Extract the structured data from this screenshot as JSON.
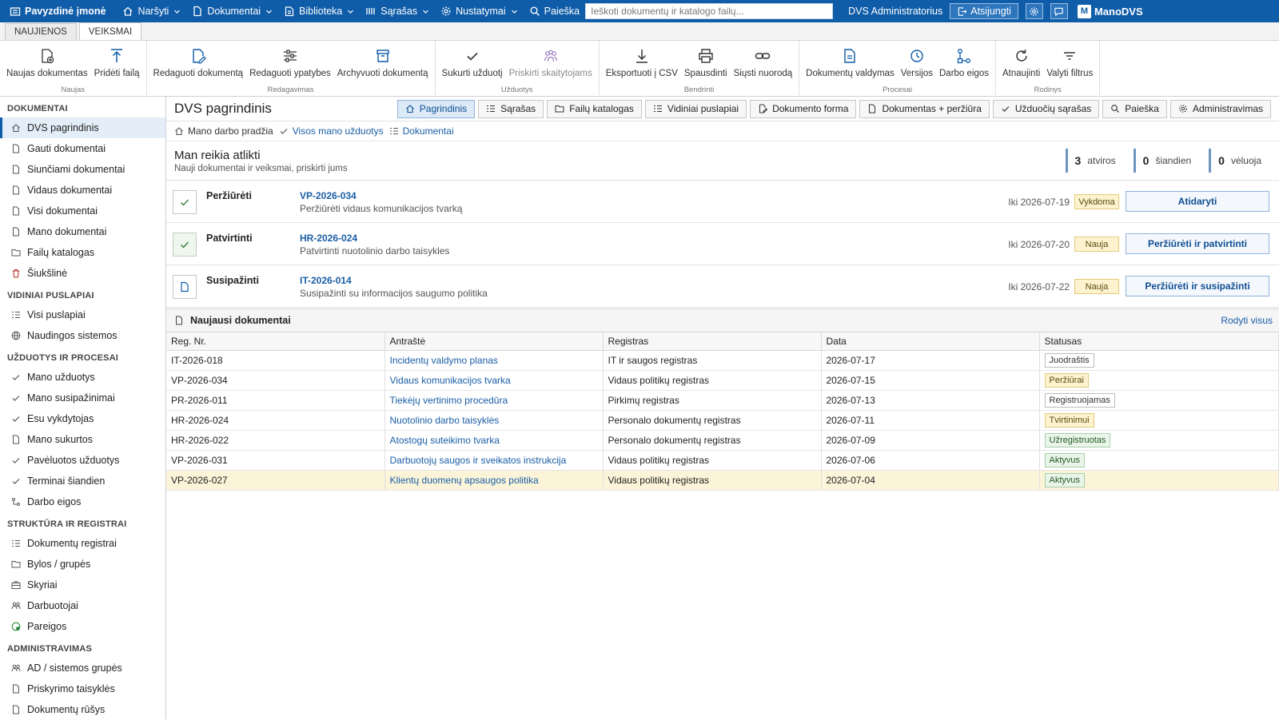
{
  "topbar": {
    "company": "Pavyzdinė įmonė",
    "menus": [
      "Naršyti",
      "Dokumentai",
      "Biblioteka",
      "Sąrašas",
      "Nustatymai"
    ],
    "search_label": "Paieška",
    "search_placeholder": "Ieškoti dokumentų ir katalogo failų...",
    "user": "DVS Administratorius",
    "logout": "Atsijungti",
    "brand": "ManoDVS",
    "brand_logo": "M"
  },
  "ribbon_tabs": [
    "NAUJIENOS",
    "VEIKSMAI"
  ],
  "ribbon": {
    "groups": [
      {
        "label": "Naujas",
        "buttons": [
          "Naujas dokumentas",
          "Pridėti failą"
        ]
      },
      {
        "label": "Redagavimas",
        "buttons": [
          "Redaguoti dokumentą",
          "Redaguoti ypatybes",
          "Archyvuoti dokumentą"
        ]
      },
      {
        "label": "Užduotys",
        "buttons": [
          "Sukurti užduotį",
          "Priskirti skaitytojams"
        ]
      },
      {
        "label": "Bendrinti",
        "buttons": [
          "Eksportuoti į CSV",
          "Spausdinti",
          "Siųsti nuorodą"
        ]
      },
      {
        "label": "Procesai",
        "buttons": [
          "Dokumentų valdymas",
          "Versijos",
          "Darbo eigos"
        ]
      },
      {
        "label": "Rodinys",
        "buttons": [
          "Atnaujinti",
          "Valyti filtrus"
        ]
      }
    ]
  },
  "sidebar": {
    "sections": [
      {
        "title": "DOKUMENTAI",
        "items": [
          "DVS pagrindinis",
          "Gauti dokumentai",
          "Siunčiami dokumentai",
          "Vidaus dokumentai",
          "Visi dokumentai",
          "Mano dokumentai",
          "Failų katalogas",
          "Šiukšlinė"
        ]
      },
      {
        "title": "VIDINIAI PUSLAPIAI",
        "items": [
          "Visi puslapiai",
          "Naudingos sistemos"
        ]
      },
      {
        "title": "UŽDUOTYS IR PROCESAI",
        "items": [
          "Mano užduotys",
          "Mano susipažinimai",
          "Esu vykdytojas",
          "Mano sukurtos",
          "Pavėluotos užduotys",
          "Terminai šiandien",
          "Darbo eigos"
        ]
      },
      {
        "title": "STRUKTŪRA IR REGISTRAI",
        "items": [
          "Dokumentų registrai",
          "Bylos / grupės",
          "Skyriai",
          "Darbuotojai",
          "Pareigos"
        ]
      },
      {
        "title": "ADMINISTRAVIMAS",
        "items": [
          "AD / sistemos grupės",
          "Priskyrimo taisyklės",
          "Dokumentų rūšys"
        ]
      }
    ]
  },
  "main": {
    "title": "DVS pagrindinis",
    "view_tabs": [
      "Pagrindinis",
      "Sąrašas",
      "Failų katalogas",
      "Vidiniai puslapiai",
      "Dokumento forma",
      "Dokumentas + peržiūra",
      "Užduočių sąrašas",
      "Paieška",
      "Administravimas"
    ],
    "breadcrumbs": [
      "Mano darbo pradžia",
      "Visos mano užduotys",
      "Dokumentai"
    ]
  },
  "todo": {
    "title": "Man reikia atlikti",
    "subtitle": "Nauji dokumentai ir veiksmai, priskirti jums",
    "counters": [
      {
        "value": "3",
        "label": "atviros"
      },
      {
        "value": "0",
        "label": "šiandien"
      },
      {
        "value": "0",
        "label": "vėluoja"
      }
    ],
    "tasks": [
      {
        "type": "Peržiūrėti",
        "reg": "VP-2026-034",
        "desc": "Peržiūrėti vidaus komunikacijos tvarką",
        "due": "Iki 2026-07-19",
        "badge": "Vykdoma",
        "action": "Atidaryti"
      },
      {
        "type": "Patvirtinti",
        "reg": "HR-2026-024",
        "desc": "Patvirtinti nuotolinio darbo taisykles",
        "due": "Iki 2026-07-20",
        "badge": "Nauja",
        "action": "Peržiūrėti ir patvirtinti"
      },
      {
        "type": "Susipažinti",
        "reg": "IT-2026-014",
        "desc": "Susipažinti su informacijos saugumo politika",
        "due": "Iki 2026-07-22",
        "badge": "Nauja",
        "action": "Peržiūrėti ir susipažinti"
      }
    ]
  },
  "recent": {
    "title": "Naujausi dokumentai",
    "show_all": "Rodyti visus",
    "columns": [
      "Reg. Nr.",
      "Antraštė",
      "Registras",
      "Data",
      "Statusas"
    ],
    "rows": [
      {
        "reg": "IT-2026-018",
        "title": "Incidentų valdymo planas",
        "registry": "IT ir saugos registras",
        "date": "2026-07-17",
        "status": "Juodraštis"
      },
      {
        "reg": "VP-2026-034",
        "title": "Vidaus komunikacijos tvarka",
        "registry": "Vidaus politikų registras",
        "date": "2026-07-15",
        "status": "Peržiūrai"
      },
      {
        "reg": "PR-2026-011",
        "title": "Tiekėjų vertinimo procedūra",
        "registry": "Pirkimų registras",
        "date": "2026-07-13",
        "status": "Registruojamas"
      },
      {
        "reg": "HR-2026-024",
        "title": "Nuotolinio darbo taisyklės",
        "registry": "Personalo dokumentų registras",
        "date": "2026-07-11",
        "status": "Tvirtinimui"
      },
      {
        "reg": "HR-2026-022",
        "title": "Atostogų suteikimo tvarka",
        "registry": "Personalo dokumentų registras",
        "date": "2026-07-09",
        "status": "Užregistruotas"
      },
      {
        "reg": "VP-2026-031",
        "title": "Darbuotojų saugos ir sveikatos instrukcija",
        "registry": "Vidaus politikų registras",
        "date": "2026-07-06",
        "status": "Aktyvus"
      },
      {
        "reg": "VP-2026-027",
        "title": "Klientų duomenų apsaugos politika",
        "registry": "Vidaus politikų registras",
        "date": "2026-07-04",
        "status": "Aktyvus"
      }
    ]
  },
  "colors": {
    "accent": "#0f5ca8",
    "link": "#1a5ea6",
    "badge_warn": "#fdf3cf",
    "badge_ok": "#eaf5ea"
  },
  "icons": {
    "topbar": [
      "building-icon",
      "home-icon",
      "document-icon",
      "library-icon",
      "list-icon",
      "gear-icon",
      "search-icon"
    ],
    "ribbon": [
      "new-document-icon",
      "upload-icon",
      "edit-document-icon",
      "sliders-icon",
      "archive-icon",
      "check-icon",
      "group-icon",
      "download-icon",
      "printer-icon",
      "link-icon",
      "document-icon",
      "history-icon",
      "workflow-icon",
      "refresh-icon",
      "filter-icon"
    ]
  }
}
